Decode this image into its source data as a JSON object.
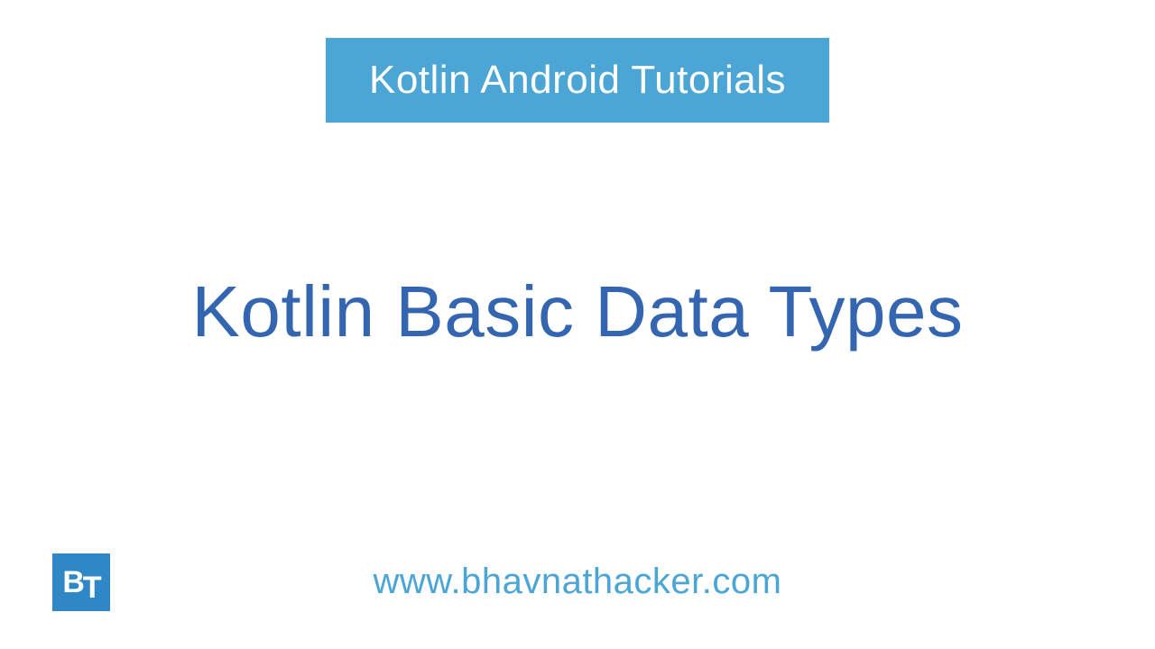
{
  "banner": {
    "text": "Kotlin Android Tutorials"
  },
  "title": {
    "text": "Kotlin Basic Data Types"
  },
  "footer": {
    "url": "www.bhavnathacker.com"
  },
  "logo": {
    "initials_b": "B",
    "initials_t": "T"
  }
}
